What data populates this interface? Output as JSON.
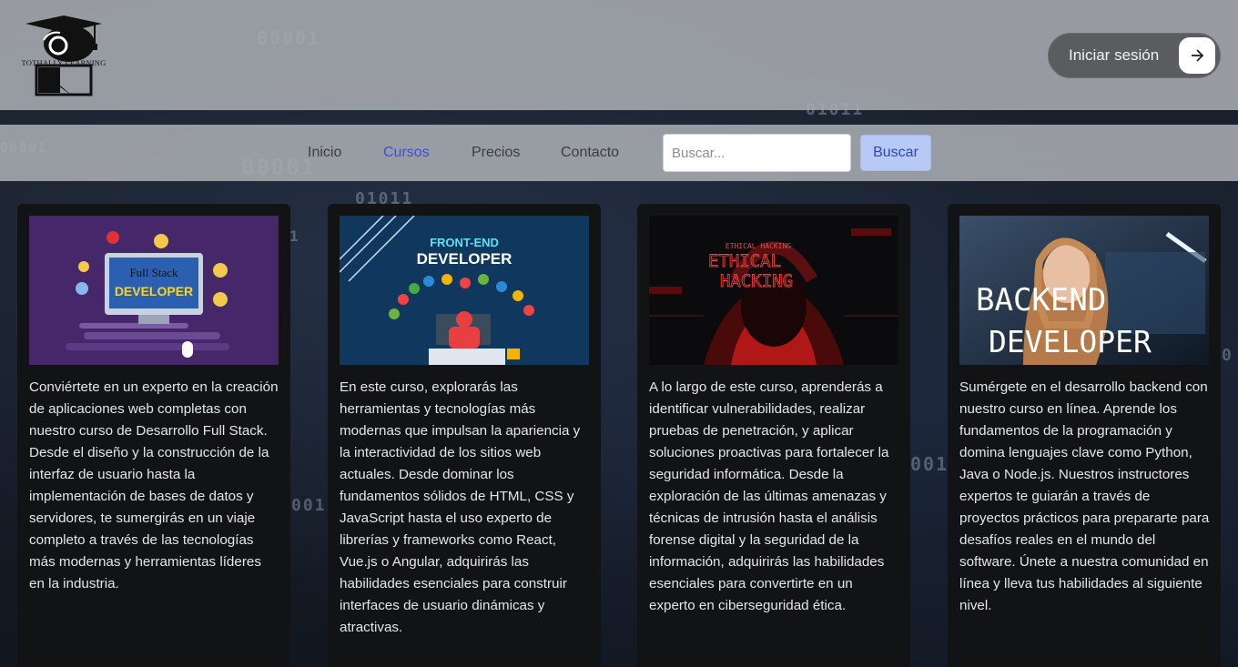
{
  "header": {
    "logo_text": "TOTHALLY LEARNING",
    "login_label": "Iniciar sesión"
  },
  "nav": {
    "links": [
      "Inicio",
      "Cursos",
      "Precios",
      "Contacto"
    ],
    "active": "Cursos",
    "search_placeholder": "Buscar...",
    "search_button": "Buscar"
  },
  "courses": [
    {
      "image_title_1": "Full Stack",
      "image_title_2": "DEVELOPER",
      "description": "Conviértete en un experto en la creación de aplicaciones web completas con nuestro curso de Desarrollo Full Stack. Desde el diseño y la construcción de la interfaz de usuario hasta la implementación de bases de datos y servidores, te sumergirás en un viaje completo a través de las tecnologías más modernas y herramientas líderes en la industria."
    },
    {
      "image_title_1": "FRONT-END",
      "image_title_2": "DEVELOPER",
      "description": "En este curso, explorarás las herramientas y tecnologías más modernas que impulsan la apariencia y la interactividad de los sitios web actuales. Desde dominar los fundamentos sólidos de HTML, CSS y JavaScript hasta el uso experto de librerías y frameworks como React, Vue.js o Angular, adquirirás las habilidades esenciales para construir interfaces de usuario dinámicas y atractivas."
    },
    {
      "image_title_1": "ETHICAL HACKING",
      "image_title_2": "ETHICAL",
      "image_title_3": "HACKING",
      "description": "A lo largo de este curso, aprenderás a identificar vulnerabilidades, realizar pruebas de penetración, y aplicar soluciones proactivas para fortalecer la seguridad informática. Desde la exploración de las últimas amenazas y técnicas de intrusión hasta el análisis forense digital y la seguridad de la información, adquirirás las habilidades esenciales para convertirte en un experto en ciberseguridad ética."
    },
    {
      "image_title_1": "BACKEND",
      "image_title_2": "DEVELOPER",
      "description": "Sumérgete en el desarrollo backend con nuestro curso en línea. Aprende los fundamentos de la programación y domina lenguajes clave como Python, Java o Node.js. Nuestros instructores expertos te guiarán a través de proyectos prácticos para prepararte para desafíos reales en el mundo del software. Únete a nuestra comunidad en línea y lleva tus habilidades al siguiente nivel."
    }
  ],
  "colors": {
    "accent": "#3d4fd6",
    "search_button_bg": "#b9c9f5",
    "card_bg": "#121315",
    "bar_bg": "#a8acb2"
  }
}
